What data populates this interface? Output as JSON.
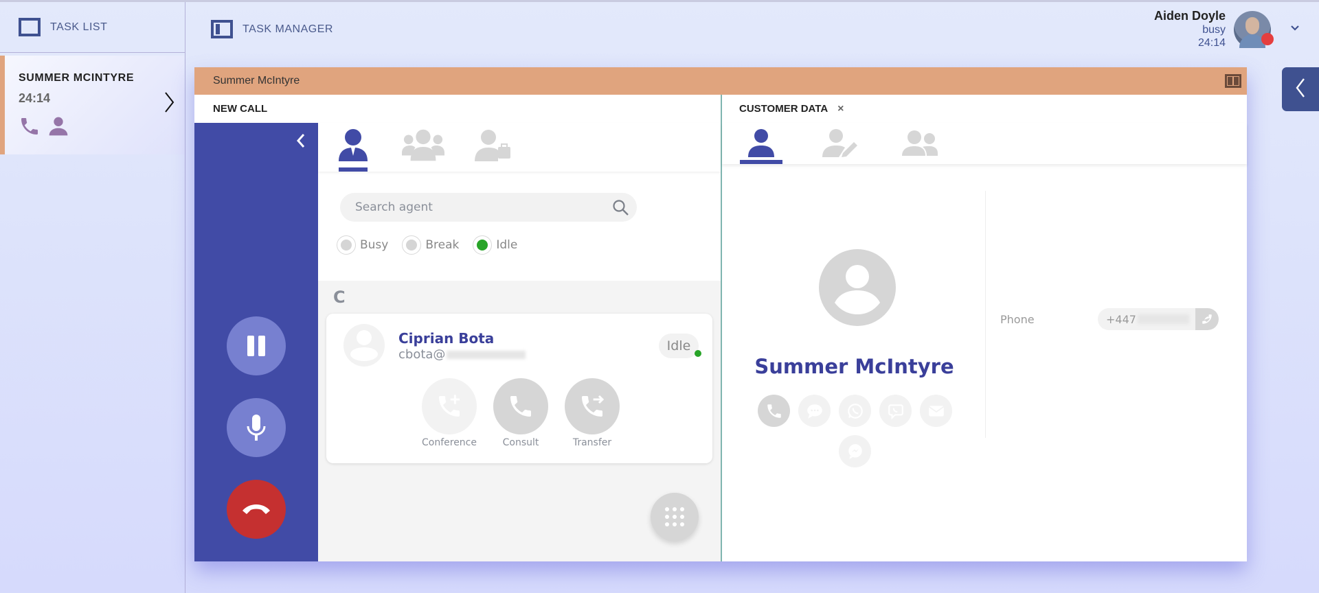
{
  "tasklist": {
    "title": "TASK LIST",
    "tasks": [
      {
        "name": "SUMMER MCINTYRE",
        "duration": "24:14",
        "channel_icons": [
          "phone-icon",
          "person-icon"
        ]
      }
    ]
  },
  "header": {
    "title": "TASK MANAGER",
    "user": {
      "name": "Aiden Doyle",
      "status": "busy",
      "time": "24:14",
      "status_color": "#e53e3e"
    }
  },
  "window": {
    "title": "Summer McIntyre",
    "new_call": {
      "label": "NEW CALL",
      "agent_tabs": [
        "agent-icon",
        "agent-group-icon",
        "agent-business-icon"
      ],
      "search": {
        "placeholder": "Search agent",
        "value": ""
      },
      "filters": [
        {
          "label": "Busy",
          "selected": false
        },
        {
          "label": "Break",
          "selected": false
        },
        {
          "label": "Idle",
          "selected": true
        }
      ],
      "group_letter": "C",
      "agents": [
        {
          "name": "Ciprian Bota",
          "email_prefix": "cbota@",
          "status": "Idle",
          "actions": [
            {
              "label": "Conference",
              "enabled": false
            },
            {
              "label": "Consult",
              "enabled": true
            },
            {
              "label": "Transfer",
              "enabled": true
            }
          ]
        }
      ]
    },
    "customer_data": {
      "label": "CUSTOMER DATA",
      "close": "×",
      "customer_name": "Summer McIntyre",
      "channels": [
        "phone",
        "chat",
        "whatsapp",
        "viber",
        "email",
        "messenger"
      ],
      "fields": [
        {
          "label": "Phone",
          "value_prefix": "+447"
        }
      ]
    }
  },
  "colors": {
    "accent": "#414ba6",
    "task_header": "#e0a47e",
    "hangup": "#c53030",
    "idle": "#28a428"
  }
}
